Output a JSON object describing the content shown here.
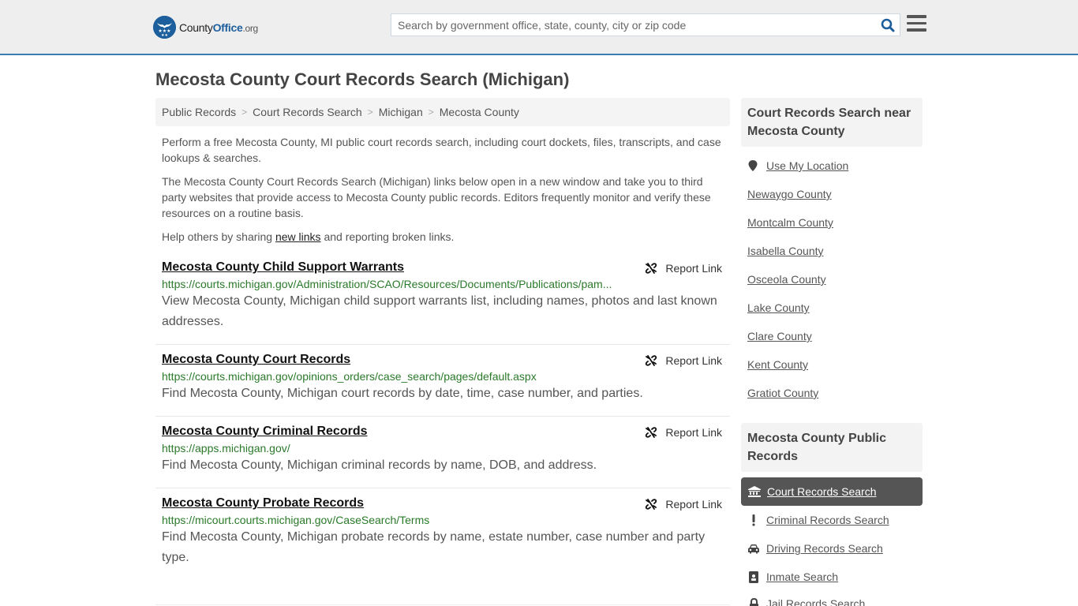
{
  "header": {
    "logo": {
      "prefix": "County",
      "brand": "Office",
      "suffix": ".org"
    },
    "search_placeholder": "Search by government office, state, county, city or zip code",
    "search_value": ""
  },
  "page": {
    "title": "Mecosta County Court Records Search (Michigan)"
  },
  "breadcrumb": [
    "Public Records",
    "Court Records Search",
    "Michigan",
    "Mecosta County"
  ],
  "breadcrumb_separator": ">",
  "intro": {
    "p1": "Perform a free Mecosta County, MI public court records search, including court dockets, files, transcripts, and case lookups & searches.",
    "p2": "The Mecosta County Court Records Search (Michigan) links below open in a new window and take you to third party websites that provide access to Mecosta County public records. Editors frequently monitor and verify these resources on a routine basis.",
    "p3_before": "Help others by sharing ",
    "p3_link": "new links",
    "p3_after": " and reporting broken links."
  },
  "report_label": "Report Link",
  "listings": [
    {
      "title": "Mecosta County Child Support Warrants",
      "url": "https://courts.michigan.gov/Administration/SCAO/Resources/Documents/Publications/pam...",
      "description": "View Mecosta County, Michigan child support warrants list, including names, photos and last known addresses."
    },
    {
      "title": "Mecosta County Court Records",
      "url": "https://courts.michigan.gov/opinions_orders/case_search/pages/default.aspx",
      "description": "Find Mecosta County, Michigan court records by date, time, case number, and parties."
    },
    {
      "title": "Mecosta County Criminal Records",
      "url": "https://apps.michigan.gov/",
      "description": "Find Mecosta County, Michigan criminal records by name, DOB, and address."
    },
    {
      "title": "Mecosta County Probate Records",
      "url": "https://micourt.courts.michigan.gov/CaseSearch/Terms",
      "description": "Find Mecosta County, Michigan probate records by name, estate number, case number and party type."
    }
  ],
  "sidebar": {
    "nearby_heading": "Court Records Search near Mecosta County",
    "use_location": "Use My Location",
    "nearby": [
      "Newaygo County",
      "Montcalm County",
      "Isabella County",
      "Osceola County",
      "Lake County",
      "Clare County",
      "Kent County",
      "Gratiot County"
    ],
    "public_heading": "Mecosta County Public Records",
    "public_items": [
      {
        "label": "Court Records Search",
        "icon": "courthouse-icon",
        "active": true
      },
      {
        "label": "Criminal Records Search",
        "icon": "exclamation-icon",
        "active": false
      },
      {
        "label": "Driving Records Search",
        "icon": "car-icon",
        "active": false
      },
      {
        "label": "Inmate Search",
        "icon": "id-badge-icon",
        "active": false
      },
      {
        "label": "Jail Records Search",
        "icon": "lock-icon",
        "active": false
      }
    ]
  },
  "colors": {
    "brand_blue": "#1d5e9d",
    "header_border": "#3a7cb0",
    "url_green": "#2a7a2a",
    "active_item_bg": "#555555"
  }
}
